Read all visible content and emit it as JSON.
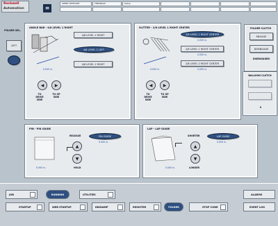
{
  "header": {
    "logo_line1": "Rockwell",
    "logo_line2": "Automation",
    "cells_row1": [
      "SPEED SETPOINT",
      "FEEDBACK",
      "Setup",
      "",
      "",
      "",
      ""
    ],
    "cells_row2": [
      "",
      "",
      "",
      "",
      "",
      "",
      ""
    ]
  },
  "left_button": {
    "label": "LEFT"
  },
  "folder_sel": {
    "title": "FOLDER SEL."
  },
  "angle_bar": {
    "title": "ANGLE BAR - 4/8 LEVEL 1 RIGHT",
    "buttons": [
      "4/8 LEVEL 1 RIGHT",
      "4/8 LEVEL 2 LEFT",
      "4/8 LEVEL 1 RIGHT"
    ],
    "value": "0.000 in.",
    "to_label": "TO\nDRIVE\nSIDE",
    "from_label": "TO OP\nSIDE"
  },
  "slitter": {
    "title": "SLITTER - 2/8 LEVEL 1 RIGHT CENTER",
    "buttons": [
      "2/8 LEVEL 1 RIGHT CENTER",
      "2/8 LEVEL 1 RIGHT CENTER",
      "2/8 LEVEL 2 RIGHT CENTER"
    ],
    "btn_values": [
      "0.000 in.",
      "0.000 in.",
      "0.000 in."
    ],
    "value": "0.000 in.",
    "to_label": "TO\nDRIVE\nSIDE",
    "from_label": "TO OP\nSIDE"
  },
  "folder_clutch": {
    "title": "FOLDER CLUTCH",
    "engage": "ENGAGE",
    "disengage": "DISENGAGE",
    "status": "DISENGAGED"
  },
  "balloon_clutch": {
    "title": "BALLOON CLUTCH",
    "count": "0"
  },
  "pin": {
    "title": "PIN - PIN GUIDE",
    "release": "RELEASE",
    "hold": "HOLD",
    "button": "PIN GUIDE",
    "btn_value": "0.000 in.",
    "value": "0.000 in."
  },
  "lap": {
    "title": "LAP - LAP GUIDE",
    "shorter": "SHORTER",
    "longer": "LONGER",
    "button": "LAP GUIDE",
    "btn_value": "0.000 in.",
    "value": "0.000 in."
  },
  "bottom": {
    "row1": [
      "JOB",
      "RUNNING",
      "UTILITIES"
    ],
    "row2": [
      "STARTUP",
      "WEB STARTUP",
      "INKDAMP",
      "REGISTER",
      "FOLDER",
      "STOP CODE"
    ],
    "alarms": "ALARMS",
    "event_log": "EVENT LOG"
  }
}
